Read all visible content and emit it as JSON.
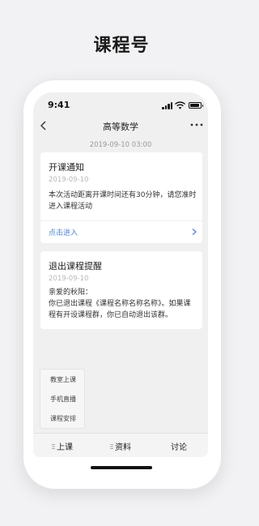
{
  "promo": {
    "title": "课程号"
  },
  "status_bar": {
    "time": "9:41"
  },
  "nav": {
    "title": "高等数学",
    "back_icon": "chevron-left-icon",
    "more_icon": "more-horizontal-icon"
  },
  "timestamp": "2019-09-10 03:00",
  "cards": [
    {
      "title": "开课通知",
      "date": "2019-09-10",
      "body": "本次活动距离开课时间还有30分钟，请您准时进入课程活动",
      "link": "点击进入"
    },
    {
      "title": "退出课程提醒",
      "date": "2019-09-10",
      "greeting": "亲爱的秋阳：",
      "body": "你已退出课程《课程名称名称名称》。如果课程有开设课程群，你已自动退出该群。"
    }
  ],
  "side_menu": {
    "items": [
      "教室上课",
      "手机直播",
      "课程安排"
    ]
  },
  "tab_bar": {
    "tabs": [
      "上课",
      "资料",
      "讨论"
    ]
  },
  "colors": {
    "link": "#4a86e8",
    "background": "#f0f0f0"
  }
}
